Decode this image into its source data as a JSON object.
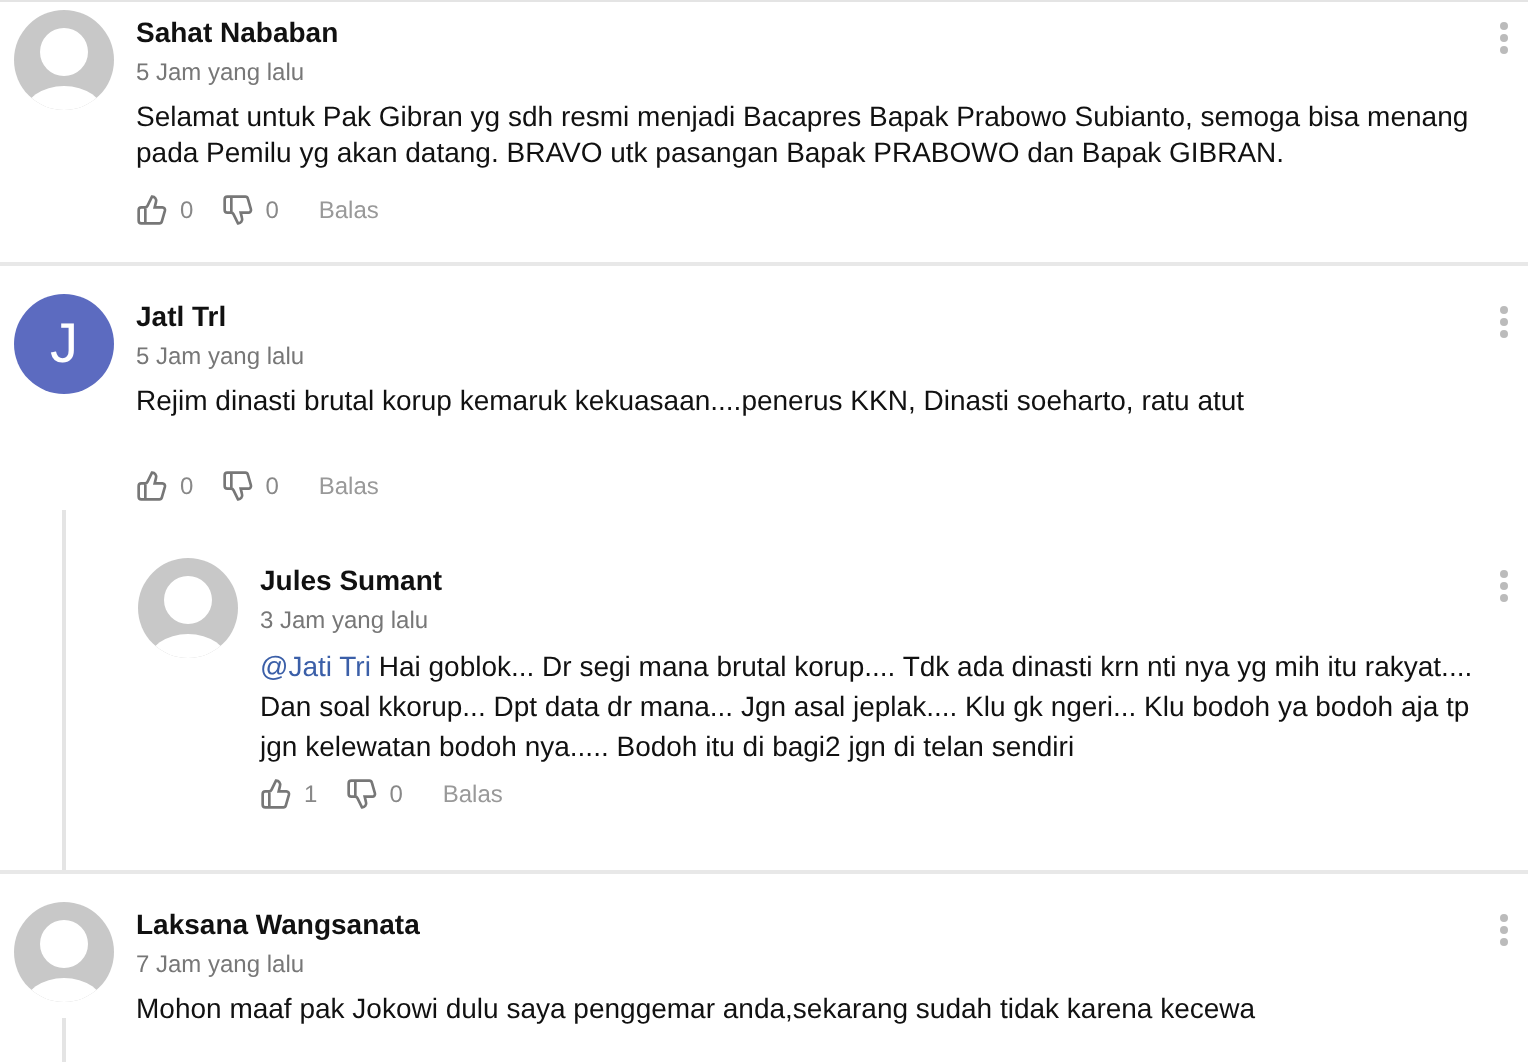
{
  "comments": [
    {
      "author": "Sahat Nababan",
      "time": "5 Jam yang lalu",
      "avatar": {
        "kind": "default"
      },
      "text": "Selamat untuk Pak Gibran yg sdh resmi menjadi Bacapres Bapak Prabowo Subianto, semoga bisa menang pada Pemilu yg akan datang. BRAVO utk pasangan Bapak PRABOWO dan Bapak GIBRAN.",
      "actions": {
        "likes": "0",
        "dislikes": "0",
        "reply": "Balas"
      }
    },
    {
      "author": "Jatl Trl",
      "time": "5 Jam yang lalu",
      "avatar": {
        "kind": "letter",
        "letter": "J",
        "color": "#5c6bc0"
      },
      "text": "Rejim dinasti brutal korup kemaruk kekuasaan....penerus KKN, Dinasti soeharto, ratu atut",
      "actions": {
        "likes": "0",
        "dislikes": "0",
        "reply": "Balas"
      },
      "replies": [
        {
          "author": "Jules Sumant",
          "time": "3 Jam yang lalu",
          "avatar": {
            "kind": "default"
          },
          "mention": "@Jati Tri",
          "text": "Hai goblok... Dr segi mana brutal korup.... Tdk ada dinasti krn nti nya yg mih itu rakyat.... Dan soal kkorup... Dpt data dr mana... Jgn asal jeplak.... Klu gk ngeri... Klu bodoh ya bodoh aja tp jgn kelewatan bodoh nya..... Bodoh itu di bagi2 jgn di telan sendiri",
          "actions": {
            "likes": "1",
            "dislikes": "0",
            "reply": "Balas"
          }
        }
      ]
    },
    {
      "author": "Laksana Wangsanata",
      "time": "7 Jam yang lalu",
      "avatar": {
        "kind": "default"
      },
      "text": "Mohon maaf pak Jokowi dulu saya penggemar anda,sekarang sudah tidak karena kecewa",
      "thread_line": true
    }
  ]
}
